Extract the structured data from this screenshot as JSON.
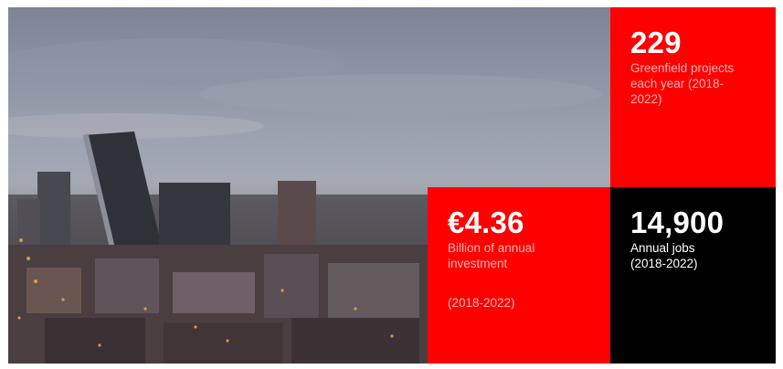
{
  "stats": {
    "projects": {
      "value": "229",
      "label_lines": [
        "Greenfield projects",
        "each year (2018-",
        "2022)"
      ]
    },
    "investment": {
      "value": "€4.36",
      "label_lines": [
        "Billion of annual",
        "investment"
      ],
      "period": "(2018-2022)"
    },
    "jobs": {
      "value": "14,900",
      "label_lines": [
        "Annual jobs",
        "(2018-2022)"
      ]
    }
  },
  "colors": {
    "accent_red": "#ff0000",
    "tile_black": "#000000",
    "faint_text": "#ffb3b3"
  },
  "image": {
    "subject": "city-skyline-photo"
  }
}
